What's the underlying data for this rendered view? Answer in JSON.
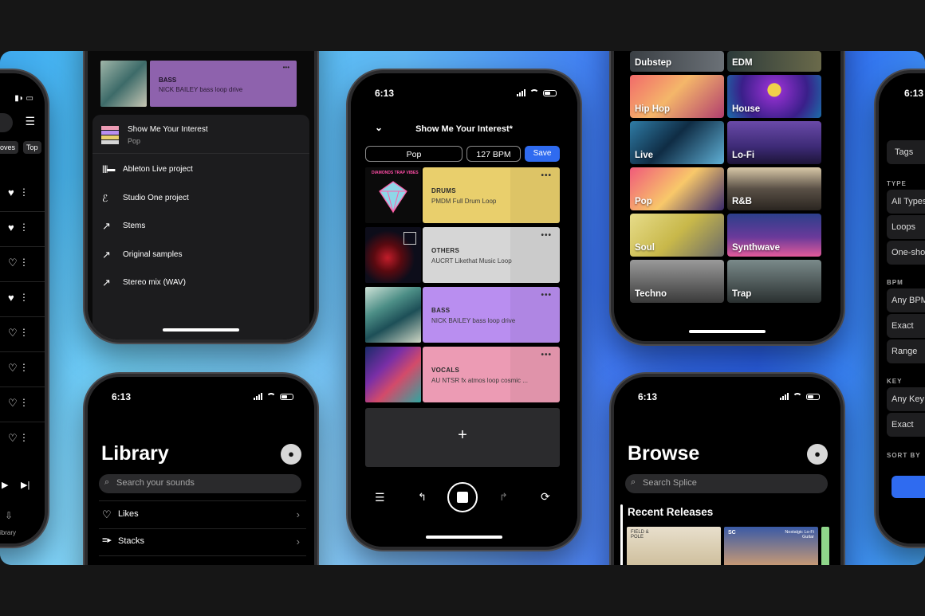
{
  "phone_left_edge": {
    "tabs": [
      "oves",
      "Top"
    ],
    "nav_label": "ibrary"
  },
  "phone_export": {
    "card": {
      "title": "BASS",
      "subtitle": "NICK BAILEY bass loop drive",
      "more": "•••"
    },
    "project": {
      "title": "Show Me Your Interest",
      "genre": "Pop"
    },
    "options": [
      {
        "label": "Ableton Live project",
        "icon": "ableton-icon"
      },
      {
        "label": "Studio One project",
        "icon": "studio-one-icon"
      },
      {
        "label": "Stems",
        "icon": "arrow-up-right-icon"
      },
      {
        "label": "Original samples",
        "icon": "arrow-up-right-icon"
      },
      {
        "label": "Stereo mix (WAV)",
        "icon": "arrow-up-right-icon"
      }
    ]
  },
  "phone_library": {
    "time": "6:13",
    "title": "Library",
    "search_placeholder": "Search your sounds",
    "items": [
      {
        "label": "Likes",
        "icon": "heart-icon"
      },
      {
        "label": "Stacks",
        "icon": "stacks-icon"
      }
    ]
  },
  "phone_stack": {
    "time": "6:13",
    "title": "Show Me Your Interest*",
    "genre": "Pop",
    "bpm": "127 BPM",
    "save_label": "Save",
    "add_label": "+",
    "layers": [
      {
        "title": "DRUMS",
        "subtitle": "PMDM Full Drum Loop",
        "color": "#e9cf6c",
        "more": "•••",
        "art_label": "DIAMONDS TRAP VIBES"
      },
      {
        "title": "OTHERS",
        "subtitle": "AUCRT Likethat Music Loop",
        "color": "#d6d6d6",
        "more": "•••"
      },
      {
        "title": "BASS",
        "subtitle": "NICK BAILEY bass loop drive",
        "color": "#b98ef0",
        "more": "•••"
      },
      {
        "title": "VOCALS",
        "subtitle": "AU NTSR fx atmos loop cosmic ...",
        "color": "#ec9bb4",
        "more": "•••"
      }
    ]
  },
  "phone_genres": {
    "genres": [
      "Dubstep",
      "EDM",
      "Hip Hop",
      "House",
      "Live",
      "Lo-Fi",
      "Pop",
      "R&B",
      "Soul",
      "Synthwave",
      "Techno",
      "Trap"
    ]
  },
  "phone_browse": {
    "time": "6:13",
    "title": "Browse",
    "search_placeholder": "Search Splice",
    "section": "Recent Releases",
    "release_labels": [
      "FIELD & POLE",
      "SC",
      "Nostalgic Lo-Fi Guitar"
    ]
  },
  "phone_filters": {
    "time": "6:13",
    "tags_label": "Tags",
    "type_header": "TYPE",
    "type_options": [
      "All Types",
      "Loops",
      "One-sho"
    ],
    "bpm_header": "BPM",
    "bpm_options": [
      "Any BPM",
      "Exact",
      "Range"
    ],
    "key_header": "KEY",
    "key_options": [
      "Any Key",
      "Exact"
    ],
    "sort_header": "SORT BY"
  },
  "colors": {
    "accent": "#2f6bf0",
    "drums": "#e9cf6c",
    "others": "#d6d6d6",
    "bass": "#b98ef0",
    "vocals": "#ec9bb4"
  }
}
